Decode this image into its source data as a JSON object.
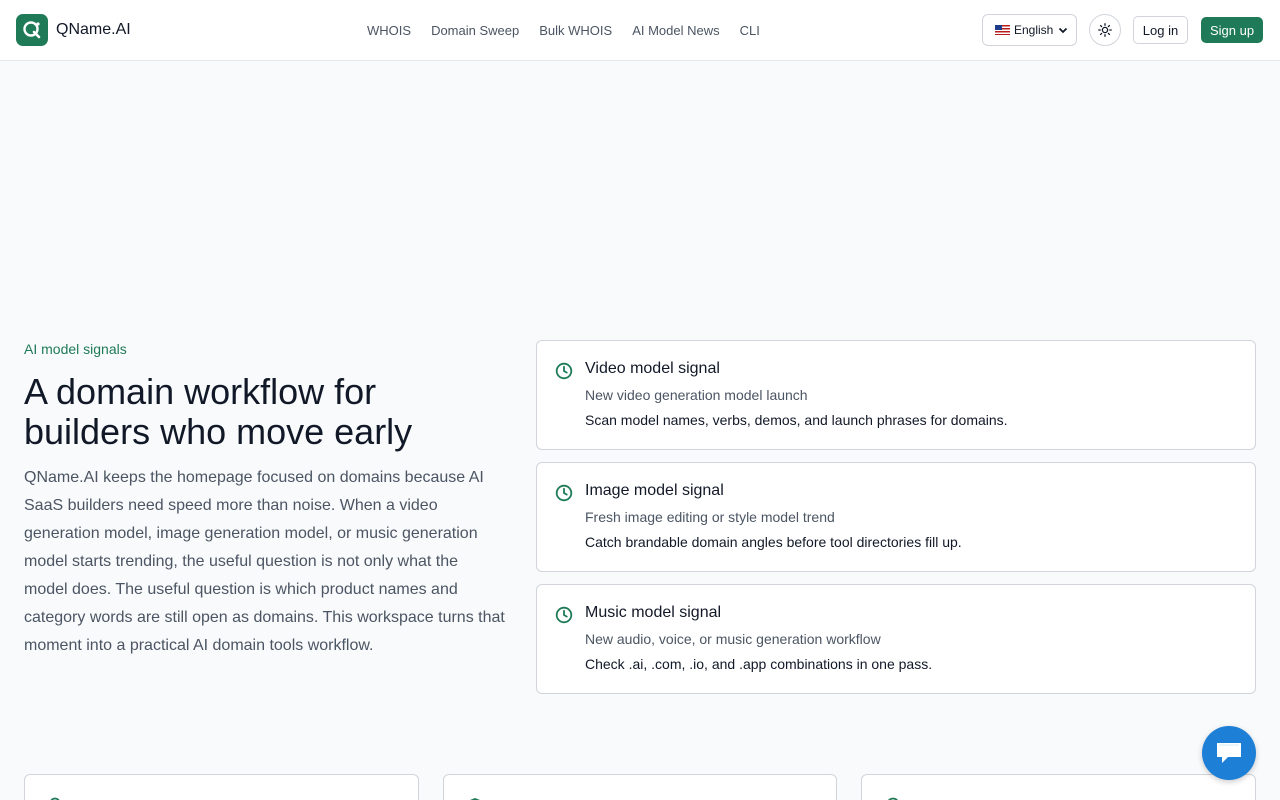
{
  "brand": {
    "name": "QName.AI"
  },
  "nav": {
    "items": [
      {
        "label": "WHOIS"
      },
      {
        "label": "Domain Sweep"
      },
      {
        "label": "Bulk WHOIS"
      },
      {
        "label": "AI Model News"
      },
      {
        "label": "CLI"
      }
    ]
  },
  "header": {
    "language": "English",
    "login_label": "Log in",
    "signup_label": "Sign up"
  },
  "hero": {
    "eyebrow": "AI model signals",
    "title": "A domain workflow for builders who move early",
    "body": "QName.AI keeps the homepage focused on domains because AI SaaS builders need speed more than noise. When a video generation model, image generation model, or music generation model starts trending, the useful question is not only what the model does. The useful question is which product names and category words are still open as domains. This workspace turns that moment into a practical AI domain tools workflow."
  },
  "signals": [
    {
      "title": "Video model signal",
      "subtitle": "New video generation model launch",
      "description": "Scan model names, verbs, demos, and launch phrases for domains."
    },
    {
      "title": "Image model signal",
      "subtitle": "Fresh image editing or style model trend",
      "description": "Catch brandable domain angles before tool directories fill up."
    },
    {
      "title": "Music model signal",
      "subtitle": "New audio, voice, or music generation workflow",
      "description": "Check .ai, .com, .io, and .app combinations in one pass."
    }
  ],
  "colors": {
    "brand_green": "#1f7a57",
    "chat_blue": "#1d7fd6"
  },
  "icons": {
    "logo": "q-logo-icon",
    "theme": "sun-icon",
    "signal": "clock-icon",
    "chat": "chat-bubble-icon"
  }
}
